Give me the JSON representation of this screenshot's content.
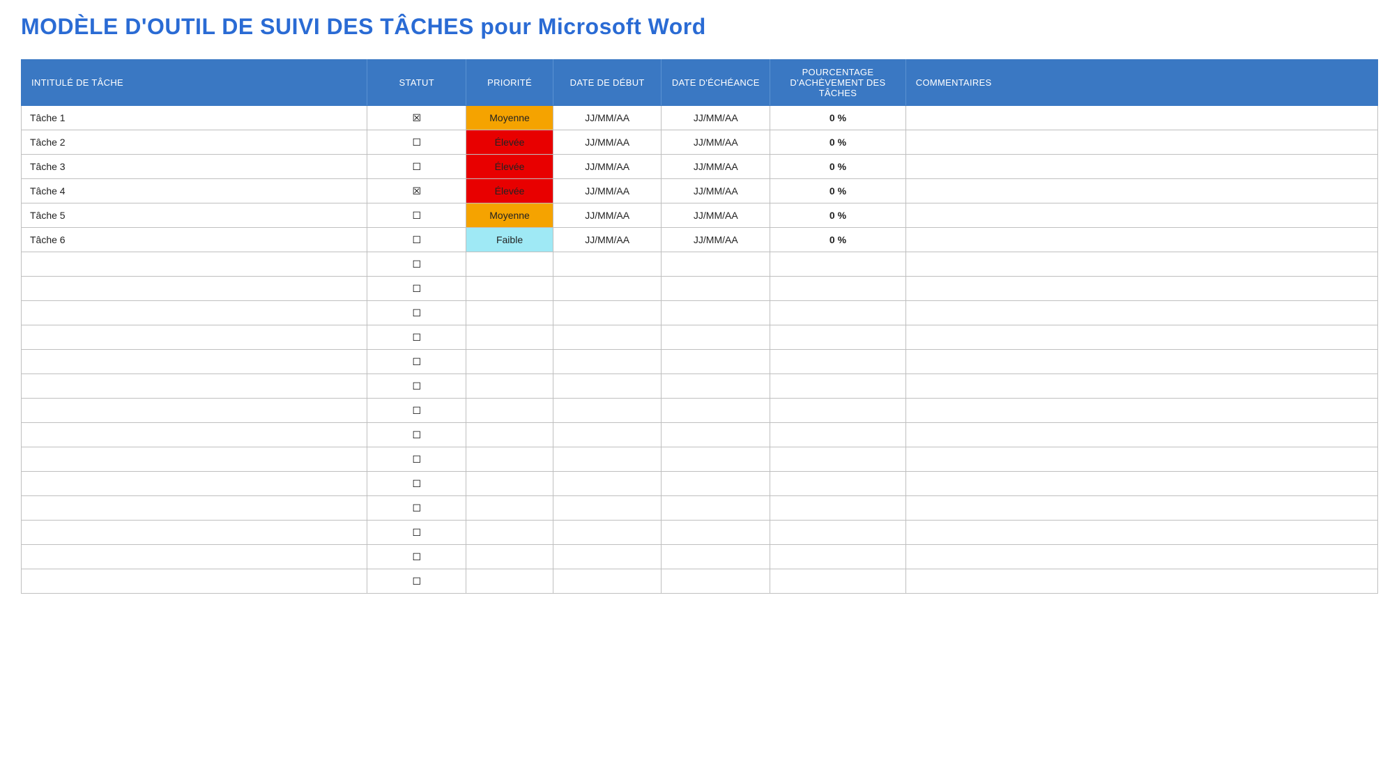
{
  "title": "MODÈLE D'OUTIL DE SUIVI DES TÂCHES pour Microsoft Word",
  "columns": {
    "name": "INTITULÉ DE TÂCHE",
    "status": "STATUT",
    "priority": "PRIORITÉ",
    "start": "DATE DE DÉBUT",
    "due": "DATE D'ÉCHÉANCE",
    "pct": "POURCENTAGE D'ACHÈVEMENT DES TÂCHES",
    "comments": "COMMENTAIRES"
  },
  "priority_colors": {
    "Moyenne": "#f5a300",
    "Élevée": "#e80000",
    "Faible": "#9fe9f5"
  },
  "glyphs": {
    "checked": "☒",
    "unchecked": "☐"
  },
  "rows": [
    {
      "name": "Tâche 1",
      "checked": true,
      "priority": "Moyenne",
      "start": "JJ/MM/AA",
      "due": "JJ/MM/AA",
      "pct": "0 %",
      "comments": ""
    },
    {
      "name": "Tâche 2",
      "checked": false,
      "priority": "Élevée",
      "start": "JJ/MM/AA",
      "due": "JJ/MM/AA",
      "pct": "0 %",
      "comments": ""
    },
    {
      "name": "Tâche 3",
      "checked": false,
      "priority": "Élevée",
      "start": "JJ/MM/AA",
      "due": "JJ/MM/AA",
      "pct": "0 %",
      "comments": ""
    },
    {
      "name": "Tâche 4",
      "checked": true,
      "priority": "Élevée",
      "start": "JJ/MM/AA",
      "due": "JJ/MM/AA",
      "pct": "0 %",
      "comments": ""
    },
    {
      "name": "Tâche 5",
      "checked": false,
      "priority": "Moyenne",
      "start": "JJ/MM/AA",
      "due": "JJ/MM/AA",
      "pct": "0 %",
      "comments": ""
    },
    {
      "name": "Tâche 6",
      "checked": false,
      "priority": "Faible",
      "start": "JJ/MM/AA",
      "due": "JJ/MM/AA",
      "pct": "0 %",
      "comments": ""
    },
    {
      "name": "",
      "checked": false,
      "priority": "",
      "start": "",
      "due": "",
      "pct": "",
      "comments": ""
    },
    {
      "name": "",
      "checked": false,
      "priority": "",
      "start": "",
      "due": "",
      "pct": "",
      "comments": ""
    },
    {
      "name": "",
      "checked": false,
      "priority": "",
      "start": "",
      "due": "",
      "pct": "",
      "comments": ""
    },
    {
      "name": "",
      "checked": false,
      "priority": "",
      "start": "",
      "due": "",
      "pct": "",
      "comments": ""
    },
    {
      "name": "",
      "checked": false,
      "priority": "",
      "start": "",
      "due": "",
      "pct": "",
      "comments": ""
    },
    {
      "name": "",
      "checked": false,
      "priority": "",
      "start": "",
      "due": "",
      "pct": "",
      "comments": ""
    },
    {
      "name": "",
      "checked": false,
      "priority": "",
      "start": "",
      "due": "",
      "pct": "",
      "comments": ""
    },
    {
      "name": "",
      "checked": false,
      "priority": "",
      "start": "",
      "due": "",
      "pct": "",
      "comments": ""
    },
    {
      "name": "",
      "checked": false,
      "priority": "",
      "start": "",
      "due": "",
      "pct": "",
      "comments": ""
    },
    {
      "name": "",
      "checked": false,
      "priority": "",
      "start": "",
      "due": "",
      "pct": "",
      "comments": ""
    },
    {
      "name": "",
      "checked": false,
      "priority": "",
      "start": "",
      "due": "",
      "pct": "",
      "comments": ""
    },
    {
      "name": "",
      "checked": false,
      "priority": "",
      "start": "",
      "due": "",
      "pct": "",
      "comments": ""
    },
    {
      "name": "",
      "checked": false,
      "priority": "",
      "start": "",
      "due": "",
      "pct": "",
      "comments": ""
    },
    {
      "name": "",
      "checked": false,
      "priority": "",
      "start": "",
      "due": "",
      "pct": "",
      "comments": ""
    }
  ]
}
